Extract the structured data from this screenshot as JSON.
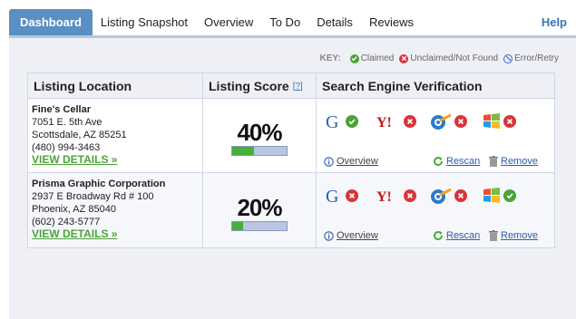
{
  "tabs": [
    {
      "label": "Dashboard",
      "active": true
    },
    {
      "label": "Listing Snapshot",
      "active": false
    },
    {
      "label": "Overview",
      "active": false
    },
    {
      "label": "To Do",
      "active": false
    },
    {
      "label": "Details",
      "active": false
    },
    {
      "label": "Reviews",
      "active": false
    }
  ],
  "help_label": "Help",
  "key": {
    "title": "KEY:",
    "claimed": "Claimed",
    "unclaimed": "Unclaimed/Not Found",
    "error": "Error/Retry"
  },
  "headers": {
    "location": "Listing Location",
    "score": "Listing Score",
    "score_help": "?",
    "verification": "Search Engine Verification"
  },
  "listings": [
    {
      "name": "Fine's Cellar",
      "address1": "7051 E. 5th Ave",
      "address2": "Scottsdale, AZ 85251",
      "phone": "(480) 994-3463",
      "view_details": "VIEW DETAILS »",
      "score_text": "40%",
      "score_value": 0.4,
      "engines": {
        "google": "claimed",
        "yahoo": "unclaimed",
        "bing": "unclaimed",
        "msn": "unclaimed"
      },
      "overview": "Overview",
      "rescan": "Rescan",
      "remove": "Remove"
    },
    {
      "name": "Prisma Graphic Corporation",
      "address1": "2937 E Broadway Rd # 100",
      "address2": "Phoenix, AZ 85040",
      "phone": "(602) 243-5777",
      "view_details": "VIEW DETAILS »",
      "score_text": "20%",
      "score_value": 0.2,
      "engines": {
        "google": "unclaimed",
        "yahoo": "unclaimed",
        "bing": "unclaimed",
        "msn": "claimed"
      },
      "overview": "Overview",
      "rescan": "Rescan",
      "remove": "Remove"
    }
  ],
  "colors": {
    "claimed": "#4aa336",
    "unclaimed": "#d8343a",
    "error": "#3a6bc8",
    "tab_active": "#5a8fc4",
    "link_green": "#4ca33a"
  }
}
